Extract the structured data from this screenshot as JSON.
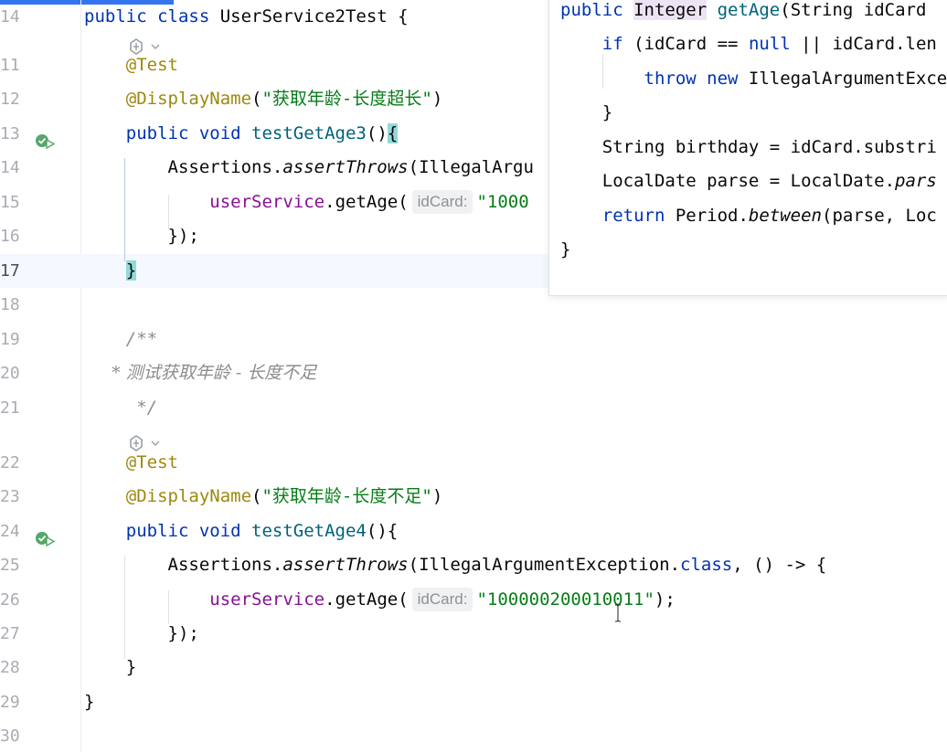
{
  "editor": {
    "lines": [
      {
        "num": "14",
        "tokens": [
          {
            "t": "public class ",
            "c": "kw"
          },
          {
            "t": "UserService2Test {",
            "c": ""
          }
        ]
      },
      {
        "num": "11",
        "tokens": [
          {
            "t": "    @Test",
            "c": "ann"
          }
        ]
      },
      {
        "num": "12",
        "tokens": [
          {
            "t": "    @DisplayName",
            "c": "ann"
          },
          {
            "t": "(",
            "c": ""
          },
          {
            "t": "\"获取年龄-长度超长\"",
            "c": "str"
          },
          {
            "t": ")",
            "c": ""
          }
        ]
      },
      {
        "num": "13",
        "tokens": [
          {
            "t": "    public void ",
            "c": "kw"
          },
          {
            "t": "testGetAge3",
            "c": "fn"
          },
          {
            "t": "()",
            "c": ""
          },
          {
            "t": "{",
            "c": "brace"
          }
        ]
      },
      {
        "num": "14",
        "tokens": [
          {
            "t": "        Assertions.",
            "c": ""
          },
          {
            "t": "assertThrows",
            "c": "it"
          },
          {
            "t": "(IllegalArgu",
            "c": ""
          }
        ]
      },
      {
        "num": "15",
        "tokens": [
          {
            "t": "            ",
            "c": ""
          },
          {
            "t": "userService",
            "c": "fld"
          },
          {
            "t": ".getAge(",
            "c": ""
          },
          {
            "t": "idCard:",
            "c": "hint"
          },
          {
            "t": "\"1000",
            "c": "str"
          }
        ]
      },
      {
        "num": "16",
        "tokens": [
          {
            "t": "        });",
            "c": ""
          }
        ]
      },
      {
        "num": "17",
        "tokens": [
          {
            "t": "    ",
            "c": ""
          },
          {
            "t": "}",
            "c": "brace"
          }
        ]
      },
      {
        "num": "18",
        "tokens": []
      },
      {
        "num": "19",
        "tokens": [
          {
            "t": "    /**",
            "c": "cmm"
          }
        ]
      },
      {
        "num": "20",
        "tokens": [
          {
            "t": "     * 测试获取年龄 - 长度不足",
            "c": "cm"
          }
        ]
      },
      {
        "num": "21",
        "tokens": [
          {
            "t": "     */",
            "c": "cmm"
          }
        ]
      },
      {
        "num": "22",
        "tokens": [
          {
            "t": "    @Test",
            "c": "ann"
          }
        ]
      },
      {
        "num": "23",
        "tokens": [
          {
            "t": "    @DisplayName",
            "c": "ann"
          },
          {
            "t": "(",
            "c": ""
          },
          {
            "t": "\"获取年龄-长度不足\"",
            "c": "str"
          },
          {
            "t": ")",
            "c": ""
          }
        ]
      },
      {
        "num": "24",
        "tokens": [
          {
            "t": "    public void ",
            "c": "kw"
          },
          {
            "t": "testGetAge4",
            "c": "fn"
          },
          {
            "t": "(){",
            "c": ""
          }
        ]
      },
      {
        "num": "25",
        "tokens": [
          {
            "t": "        Assertions.",
            "c": ""
          },
          {
            "t": "assertThrows",
            "c": "it"
          },
          {
            "t": "(IllegalArgumentException.",
            "c": ""
          },
          {
            "t": "class",
            "c": "kw"
          },
          {
            "t": ", () -> {",
            "c": ""
          }
        ]
      },
      {
        "num": "26",
        "tokens": [
          {
            "t": "            ",
            "c": ""
          },
          {
            "t": "userService",
            "c": "fld"
          },
          {
            "t": ".getAge(",
            "c": ""
          },
          {
            "t": "idCard:",
            "c": "hint"
          },
          {
            "t": "\"100000200010011\"",
            "c": "str"
          },
          {
            "t": ");",
            "c": ""
          }
        ]
      },
      {
        "num": "27",
        "tokens": [
          {
            "t": "        });",
            "c": ""
          }
        ]
      },
      {
        "num": "28",
        "tokens": [
          {
            "t": "    }",
            "c": ""
          }
        ]
      },
      {
        "num": "29",
        "tokens": [
          {
            "t": "}",
            "c": ""
          }
        ]
      },
      {
        "num": "30",
        "tokens": []
      }
    ]
  },
  "popup": {
    "lines": [
      {
        "tokens": [
          {
            "t": "public ",
            "c": "kw"
          },
          {
            "t": "Integer",
            "c": "caret"
          },
          {
            "t": " ",
            "c": ""
          },
          {
            "t": "getAge",
            "c": "fn"
          },
          {
            "t": "(String idCard",
            "c": ""
          }
        ]
      },
      {
        "tokens": [
          {
            "t": "    ",
            "c": ""
          },
          {
            "t": "if",
            "c": "kw"
          },
          {
            "t": " (idCard == ",
            "c": ""
          },
          {
            "t": "null",
            "c": "kw"
          },
          {
            "t": " || idCard.len",
            "c": ""
          }
        ]
      },
      {
        "tokens": [
          {
            "t": "        ",
            "c": ""
          },
          {
            "t": "throw new",
            "c": "kw"
          },
          {
            "t": " IllegalArgumentExce",
            "c": ""
          }
        ]
      },
      {
        "tokens": [
          {
            "t": "    }",
            "c": ""
          }
        ]
      },
      {
        "tokens": [
          {
            "t": "    String birthday = idCard.substri",
            "c": ""
          }
        ]
      },
      {
        "tokens": [
          {
            "t": "    LocalDate parse = LocalDate.",
            "c": ""
          },
          {
            "t": "pars",
            "c": "it"
          }
        ]
      },
      {
        "tokens": [
          {
            "t": "    ",
            "c": ""
          },
          {
            "t": "return",
            "c": "kw"
          },
          {
            "t": " Period.",
            "c": ""
          },
          {
            "t": "between",
            "c": "it"
          },
          {
            "t": "(parse, Loc",
            "c": ""
          }
        ]
      },
      {
        "tokens": [
          {
            "t": "}",
            "c": ""
          }
        ]
      }
    ]
  },
  "icons": {
    "run": "run-test-icon",
    "ai": "ai-assistant-icon",
    "cursor": "text-cursor-icon"
  },
  "colors": {
    "keyword": "#0033b3",
    "annotation": "#9e880d",
    "string": "#067d17",
    "method": "#00627a",
    "field": "#871094",
    "comment": "#8c8c8c"
  }
}
